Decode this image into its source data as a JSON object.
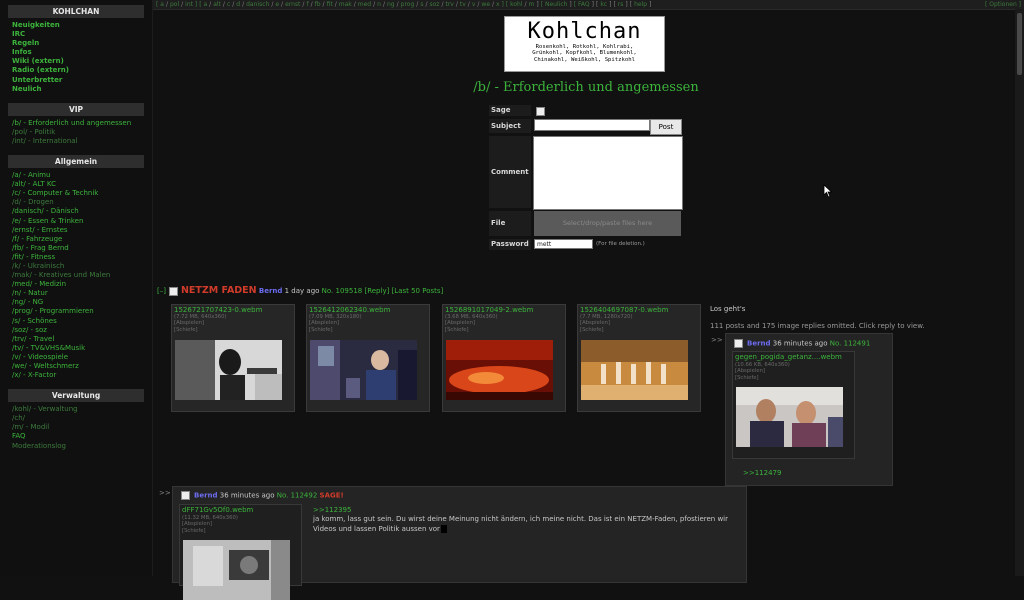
{
  "sidebar": {
    "site_title": "KOHLCHAN",
    "site_links": [
      "Neuigkeiten",
      "IRC",
      "Regeln",
      "Infos",
      "Wiki (extern)",
      "Radio (extern)",
      "Unterbretter",
      "Neulich"
    ],
    "vip_title": "VIP",
    "vip_links": [
      "/b/ - Erforderlich und angemessen",
      "/pol/ - Politik",
      "/int/ - International"
    ],
    "general_title": "Allgemein",
    "general_links": [
      "/a/ - Animu",
      "/alt/ - ALT KC",
      "/c/ - Computer & Technik",
      "/d/ - Drogen",
      "/danisch/ - Dänisch",
      "/e/ - Essen & Trinken",
      "/ernst/ - Ernstes",
      "/f/ - Fahrzeuge",
      "/fb/ - Frag Bernd",
      "/fit/ - Fitness",
      "/k/ - Ukrainisch",
      "/mak/ - Kreatives und Malen",
      "/med/ - Medizin",
      "/n/ - Natur",
      "/ng/ - NG",
      "/prog/ - Programmieren",
      "/s/ - Schönes",
      "/soz/ - soz",
      "/trv/ - Travel",
      "/tv/ - TV&VHS&Musik",
      "/v/ - Videospiele",
      "/we/ - Weltschmerz",
      "/x/ - X-Factor"
    ],
    "admin_title": "Verwaltung",
    "admin_links": [
      "/kohl/ - Verwaltung",
      "/ch/",
      "/m/ - Modil",
      "FAQ",
      "Moderationslog"
    ]
  },
  "topbar": {
    "items": [
      "[ a",
      "/",
      "pol",
      "/",
      "int ]",
      "[ a",
      "/",
      "alt",
      "/",
      "c",
      "/",
      "d",
      "/",
      "danisch",
      "/",
      "e",
      "/",
      "ernst",
      "/",
      "f",
      "/",
      "fb",
      "/",
      "fit",
      "/",
      "mak",
      "/",
      "med",
      "/",
      "n",
      "/",
      "ng",
      "/",
      "prog",
      "/",
      "s",
      "/",
      "soz",
      "/",
      "trv",
      "/",
      "tv",
      "/",
      "v",
      "/",
      "we",
      "/",
      "x ]",
      "[ kohl",
      "/",
      "m",
      "]",
      "[ Neulich",
      "]",
      "[ FAQ",
      "]",
      "[",
      "kc",
      "]",
      "[",
      "rs",
      "]",
      "[",
      "help",
      "]"
    ],
    "options": "[ Optionen ]"
  },
  "logo": {
    "title": "Kohlchan",
    "line1": "Rosenkohl, Rotkohl, Kohlrabi,",
    "line2": "Grünkohl, Kopfkohl, Blumenkohl,",
    "line3": "Chinakohl, Weißkohl, Spitzkohl"
  },
  "board_title": "/b/ - Erforderlich und angemessen",
  "form": {
    "sage_label": "Sage",
    "subject_label": "Subject",
    "post_button": "Post",
    "comment_label": "Comment",
    "file_label": "File",
    "file_placeholder": "Select/drop/paste files here",
    "password_label": "Password",
    "password_value": "mett",
    "password_hint": "(For file deletion.)"
  },
  "thread": {
    "expand": "[–]",
    "subject": "NETZM FADEN",
    "name": "Bernd",
    "time": "1 day ago",
    "number": "No. 109518",
    "reply_link": "[Reply]",
    "last50_link": "[Last 50 Posts]",
    "text": "Los geht's",
    "omitted": "111 posts and 175 image replies omitted. Click reply to view.",
    "files": [
      {
        "name": "1526721707423-0.webm",
        "size": "(7.72 MB, 640x360)",
        "play": "[Abspielen]",
        "author": "[Schiefe]"
      },
      {
        "name": "1526412062340.webm",
        "size": "(7.09 MB, 320x180)",
        "play": "[Abspielen]",
        "author": "[Schiefe]"
      },
      {
        "name": "1526891017049-2.webm",
        "size": "(3.68 MB, 640x360)",
        "play": "[Abspielen]",
        "author": "[Schiefe]"
      },
      {
        "name": "1526404697087-0.webm",
        "size": "(7.7 MB, 1280x720)",
        "play": "[Abspielen]",
        "author": "[Schiefe]"
      }
    ]
  },
  "reply1": {
    "arrow": ">>",
    "name": "Bernd",
    "time": "36 minutes ago",
    "number": "No. 112491",
    "file": {
      "name": "gegen_pogida_getanz....webm",
      "size": "(10.66 KB, 640x360)",
      "play": "[Abspielen]",
      "author": "[Schiefe]"
    },
    "backlink": ">>112479"
  },
  "reply2": {
    "arrow": ">>",
    "name": "Bernd",
    "time": "36 minutes ago",
    "number": "No. 112492",
    "sage": "SAGE!",
    "file": {
      "name": "dFF71Gv5Of0.webm",
      "size": "(11.32 MB, 640x360)",
      "play": "[Abspielen]",
      "author": "[Schiefe]"
    },
    "quote": ">>112395",
    "text": "ja komm, lass gut sein. Du wirst deine Meinung nicht ändern, ich meine nicht. Das ist ein NETZM-Faden, pfostieren wir Videos und lassen Politik aussen vor"
  }
}
